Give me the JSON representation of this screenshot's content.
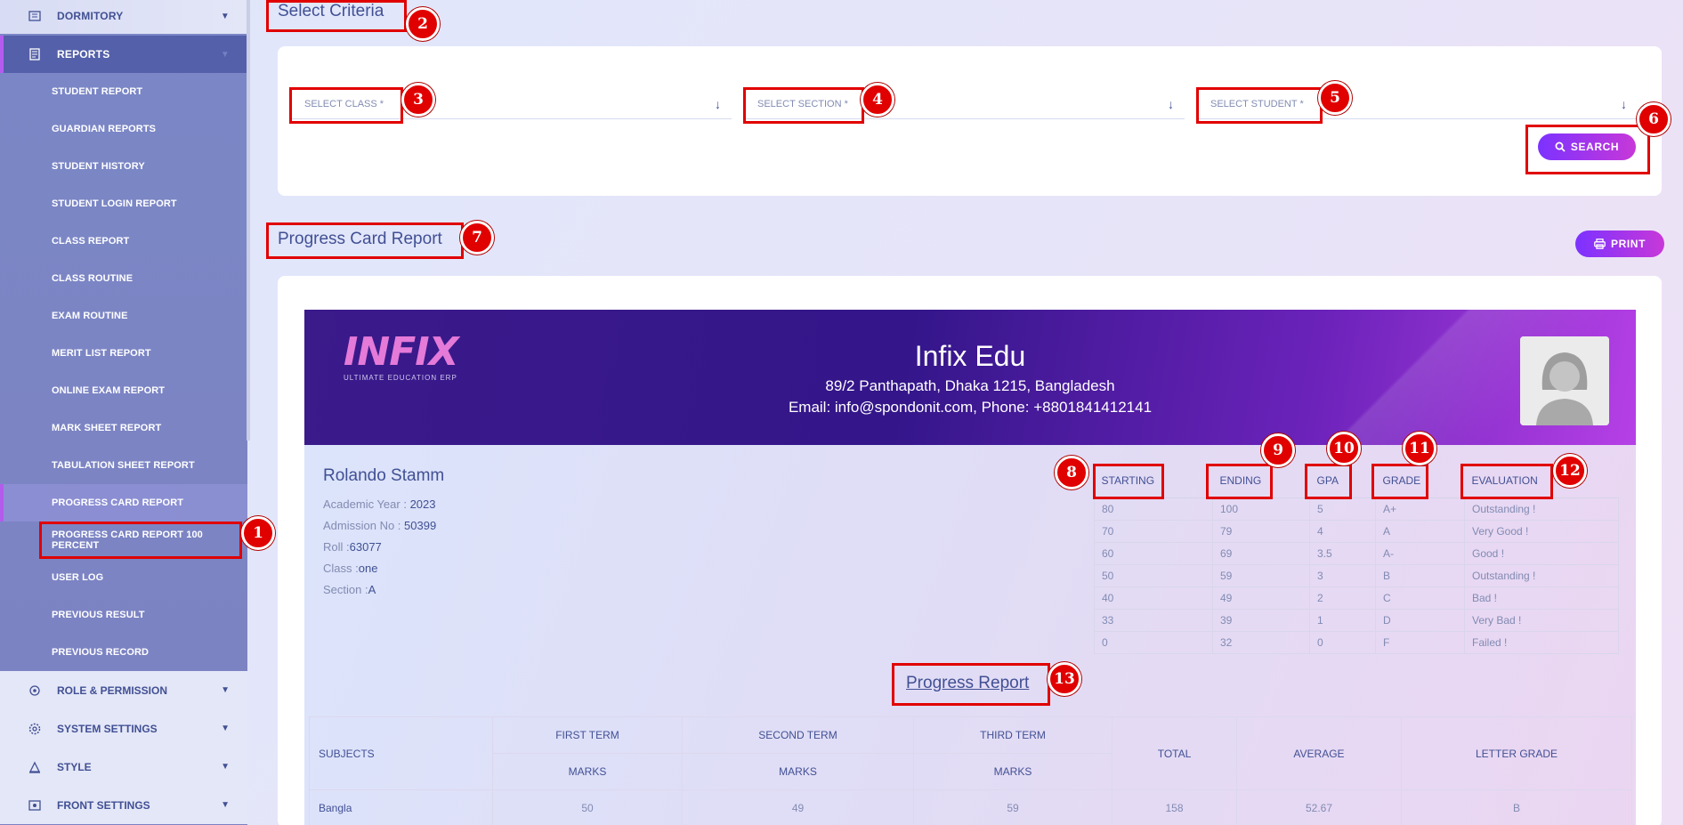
{
  "sidebar": {
    "dormitory": "DORMITORY",
    "reports": "REPORTS",
    "items": [
      "STUDENT REPORT",
      "GUARDIAN REPORTS",
      "STUDENT HISTORY",
      "STUDENT LOGIN REPORT",
      "CLASS REPORT",
      "CLASS ROUTINE",
      "EXAM ROUTINE",
      "MERIT LIST REPORT",
      "ONLINE EXAM REPORT",
      "MARK SHEET REPORT",
      "TABULATION SHEET REPORT",
      "PROGRESS CARD REPORT",
      "PROGRESS CARD REPORT 100 PERCENT",
      "USER LOG",
      "PREVIOUS RESULT",
      "PREVIOUS RECORD"
    ],
    "role_permission": "ROLE & PERMISSION",
    "system_settings": "SYSTEM SETTINGS",
    "style": "STYLE",
    "front_settings": "FRONT SETTINGS"
  },
  "criteria": {
    "title": "Select Criteria",
    "class_placeholder": "SELECT CLASS *",
    "section_placeholder": "SELECT SECTION *",
    "student_placeholder": "SELECT STUDENT *",
    "search_label": "SEARCH"
  },
  "report": {
    "title": "Progress Card Report",
    "print_label": "PRINT",
    "logo_text": "INFIX",
    "logo_sub": "ULTIMATE EDUCATION ERP",
    "school_name": "Infix Edu",
    "address": "89/2 Panthapath, Dhaka 1215, Bangladesh",
    "contact": "Email: info@spondonit.com, Phone: +8801841412141",
    "student_name": "Rolando Stamm",
    "academic_year_label": "Academic Year : ",
    "academic_year": "2023",
    "admission_label": "Admission No : ",
    "admission_no": "50399",
    "roll_label": "Roll :",
    "roll": "63077",
    "class_label": "Class :",
    "class": "one",
    "section_label": "Section :",
    "section": "A",
    "progress_title": "Progress Report"
  },
  "grade_table": {
    "headers": [
      "STARTING",
      "ENDING",
      "GPA",
      "GRADE",
      "EVALUATION"
    ],
    "rows": [
      [
        "80",
        "100",
        "5",
        "A+",
        "Outstanding !"
      ],
      [
        "70",
        "79",
        "4",
        "A",
        "Very Good !"
      ],
      [
        "60",
        "69",
        "3.5",
        "A-",
        "Good !"
      ],
      [
        "50",
        "59",
        "3",
        "B",
        "Outstanding !"
      ],
      [
        "40",
        "49",
        "2",
        "C",
        "Bad !"
      ],
      [
        "33",
        "39",
        "1",
        "D",
        "Very Bad !"
      ],
      [
        "0",
        "32",
        "0",
        "F",
        "Failed !"
      ]
    ]
  },
  "marks_table": {
    "subjects": "SUBJECTS",
    "first_term": "FIRST TERM",
    "second_term": "SECOND TERM",
    "third_term": "THIRD TERM",
    "marks": "MARKS",
    "total": "TOTAL",
    "average": "AVERAGE",
    "letter_grade": "LETTER GRADE",
    "rows": [
      [
        "Bangla",
        "50",
        "49",
        "59",
        "158",
        "52.67",
        "B"
      ]
    ]
  },
  "annotations": [
    "1",
    "2",
    "3",
    "4",
    "5",
    "6",
    "7",
    "8",
    "9",
    "10",
    "11",
    "12",
    "13"
  ]
}
